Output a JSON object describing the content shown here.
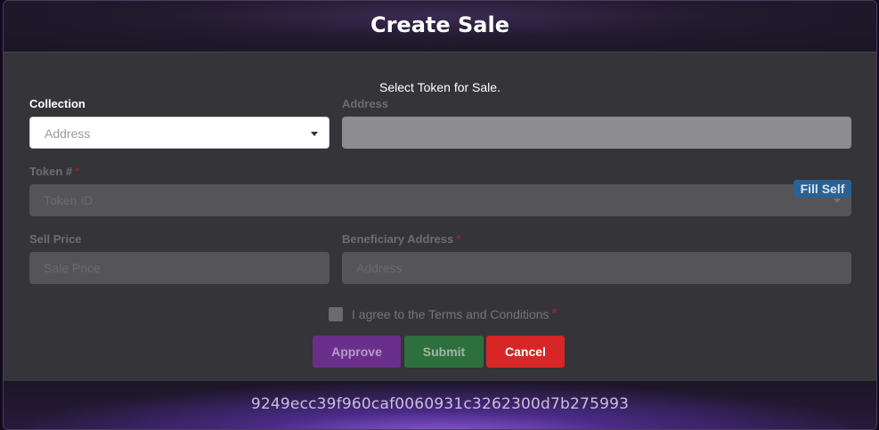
{
  "modal": {
    "title": "Create Sale"
  },
  "form": {
    "subtitle": "Select Token for Sale.",
    "collection": {
      "label": "Collection",
      "placeholder": "Address"
    },
    "address": {
      "label": "Address",
      "value": ""
    },
    "token": {
      "label": "Token #",
      "required_mark": "*",
      "placeholder": "Token ID"
    },
    "sell_price": {
      "label": "Sell Price",
      "placeholder": "Sale Price"
    },
    "beneficiary": {
      "label": "Beneficiary Address",
      "required_mark": "*",
      "placeholder": "Address",
      "fill_self_label": "Fill Self"
    },
    "terms": {
      "text": "I agree to the Terms and Conditions",
      "required_mark": "*",
      "checked": false
    }
  },
  "buttons": {
    "approve": "Approve",
    "submit": "Submit",
    "cancel": "Cancel"
  },
  "footer": {
    "hash": "9249ecc39f960caf0060931c3262300d7b275993"
  },
  "colors": {
    "approve": "#6a2f8a",
    "submit": "#2e6f3e",
    "cancel": "#d62626",
    "fill_self": "#2a6296"
  }
}
